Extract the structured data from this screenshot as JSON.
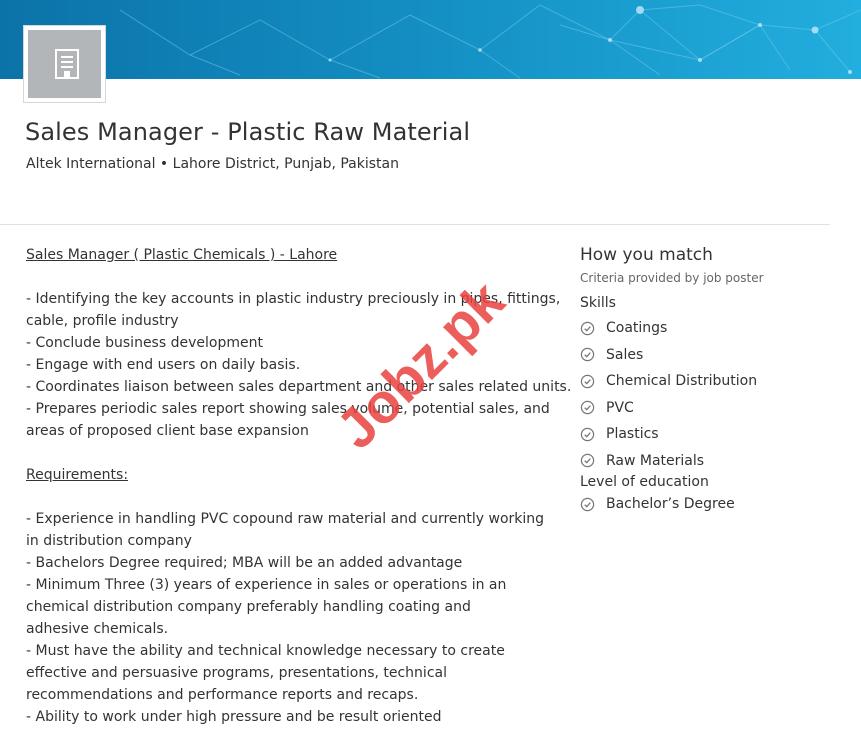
{
  "colors": {
    "banner_start": "#0a74a8",
    "banner_end": "#1aa7d3",
    "text": "#333333",
    "muted": "#666666",
    "watermark": "#e8423f"
  },
  "company_logo": {
    "icon": "building-icon"
  },
  "job": {
    "title": "Sales Manager - Plastic Raw Material",
    "subtitle": "Altek International • Lahore District, Punjab, Pakistan"
  },
  "description": {
    "heading": "Sales Manager ( Plastic  Chemicals ) - Lahore",
    "lines": [
      "- Identifying the key accounts in plastic industry preciously in pipes, fittings,",
      "cable, profile industry",
      "- Conclude business development",
      "- Engage with end users on daily basis.",
      "- Coordinates liaison between sales department and other sales related units.",
      "- Prepares periodic sales report showing sales volume, potential sales, and",
      "areas of proposed client base expansion"
    ],
    "requirements_heading": "Requirements:",
    "requirements_lines": [
      "- Experience in handling PVC copound raw material and currently working",
      "in distribution company",
      "- Bachelors Degree required; MBA will be an added advantage",
      "- Minimum Three (3) years of experience in sales or operations in an",
      "chemical distribution company preferably handling coating and",
      "adhesive chemicals.",
      "- Must have the ability and technical knowledge necessary to create",
      "effective and persuasive programs, presentations, technical",
      "recommendations and performance reports and recaps.",
      "- Ability to work under high pressure and be result oriented"
    ]
  },
  "match": {
    "title": "How you match",
    "criteria_note": "Criteria provided by job poster",
    "skills_label": "Skills",
    "skills": [
      "Coatings",
      "Sales",
      "Chemical Distribution",
      "PVC",
      "Plastics",
      "Raw Materials"
    ],
    "education_label": "Level of education",
    "education": [
      "Bachelor’s Degree"
    ],
    "check_icon": "check-circle-icon"
  },
  "watermark": {
    "text": "Jobz.pk"
  }
}
